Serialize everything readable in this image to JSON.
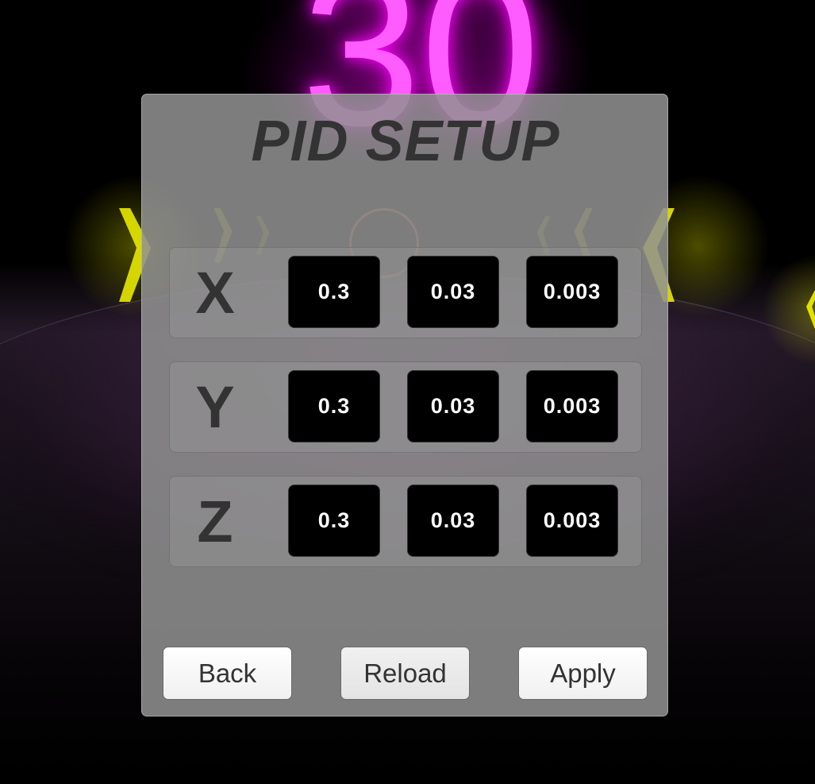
{
  "hud": {
    "score": "30"
  },
  "colors": {
    "neon_magenta": "#ff5cff",
    "neon_yellow": "#e8e800",
    "panel_bg": "#919191",
    "field_bg": "#000000",
    "text_dark": "#333333"
  },
  "panel": {
    "title": "PID SETUP",
    "rows": [
      {
        "axis": "X",
        "gains": [
          "0.3",
          "0.03",
          "0.003"
        ]
      },
      {
        "axis": "Y",
        "gains": [
          "0.3",
          "0.03",
          "0.003"
        ]
      },
      {
        "axis": "Z",
        "gains": [
          "0.3",
          "0.03",
          "0.003"
        ]
      }
    ],
    "buttons": {
      "back": "Back",
      "reload": "Reload",
      "apply": "Apply"
    }
  }
}
